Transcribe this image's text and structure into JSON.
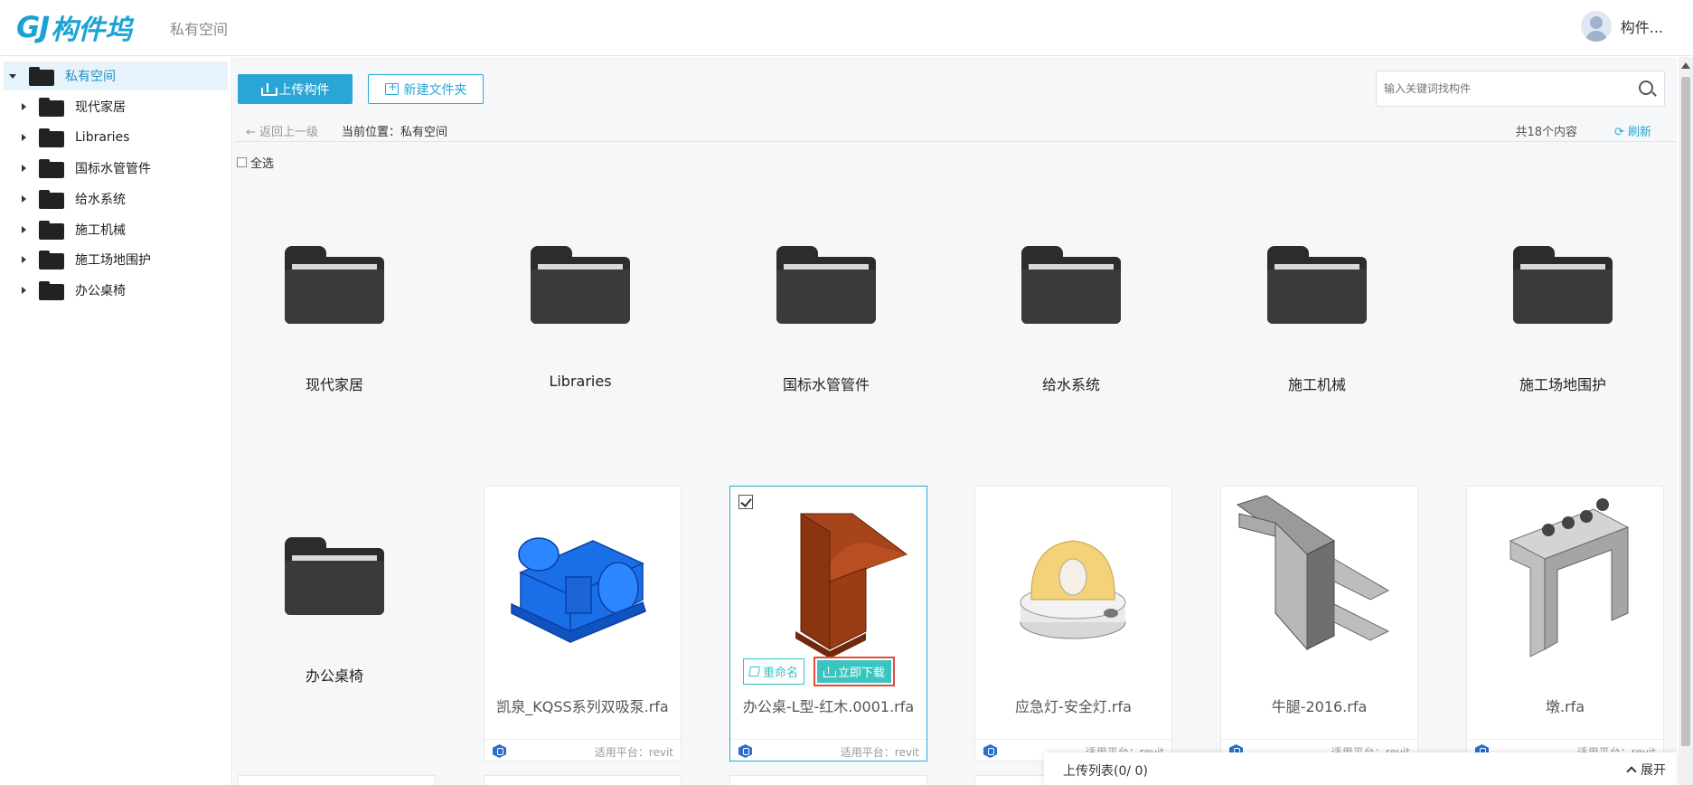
{
  "header": {
    "logo_mark": "GJ",
    "logo_text": "构件坞",
    "space_title": "私有空间",
    "user_name": "构件..."
  },
  "sidebar": {
    "root": "私有空间",
    "items": [
      {
        "label": "现代家居"
      },
      {
        "label": "Libraries"
      },
      {
        "label": "国标水管管件"
      },
      {
        "label": "给水系统"
      },
      {
        "label": "施工机械"
      },
      {
        "label": "施工场地围护"
      },
      {
        "label": "办公桌椅"
      }
    ]
  },
  "toolbar": {
    "upload_label": "上传构件",
    "new_folder_label": "新建文件夹",
    "search_placeholder": "输入关键词找构件"
  },
  "crumbbar": {
    "back_label": "返回上一级",
    "location_label": "当前位置：",
    "location_value": "私有空间",
    "count_label": "共18个内容",
    "refresh_label": "刷新"
  },
  "select_all_label": "全选",
  "folders": [
    {
      "name": "现代家居"
    },
    {
      "name": "Libraries"
    },
    {
      "name": "国标水管管件"
    },
    {
      "name": "给水系统"
    },
    {
      "name": "施工机械"
    },
    {
      "name": "施工场地围护"
    },
    {
      "name": "办公桌椅"
    }
  ],
  "files": [
    {
      "name": "凯泉_KQSS系列双吸泵.rfa",
      "platform": "适用平台：revit"
    },
    {
      "name": "办公桌-L型-红木.0001.rfa",
      "platform": "适用平台：revit",
      "selected": true
    },
    {
      "name": "应急灯-安全灯.rfa",
      "platform": "适用平台：revit"
    },
    {
      "name": "牛腿-2016.rfa",
      "platform": "适用平台：revit"
    },
    {
      "name": "墩.rfa",
      "platform": "适用平台：revit"
    }
  ],
  "card_actions": {
    "rename_label": "重命名",
    "download_label": "立即下载"
  },
  "upload_panel": {
    "label": "上传列表(0/ 0)",
    "expand_label": "展开"
  },
  "colors": {
    "accent": "#2aa6d6",
    "download": "#3cc5c0",
    "highlight_border": "#e24b3b"
  }
}
